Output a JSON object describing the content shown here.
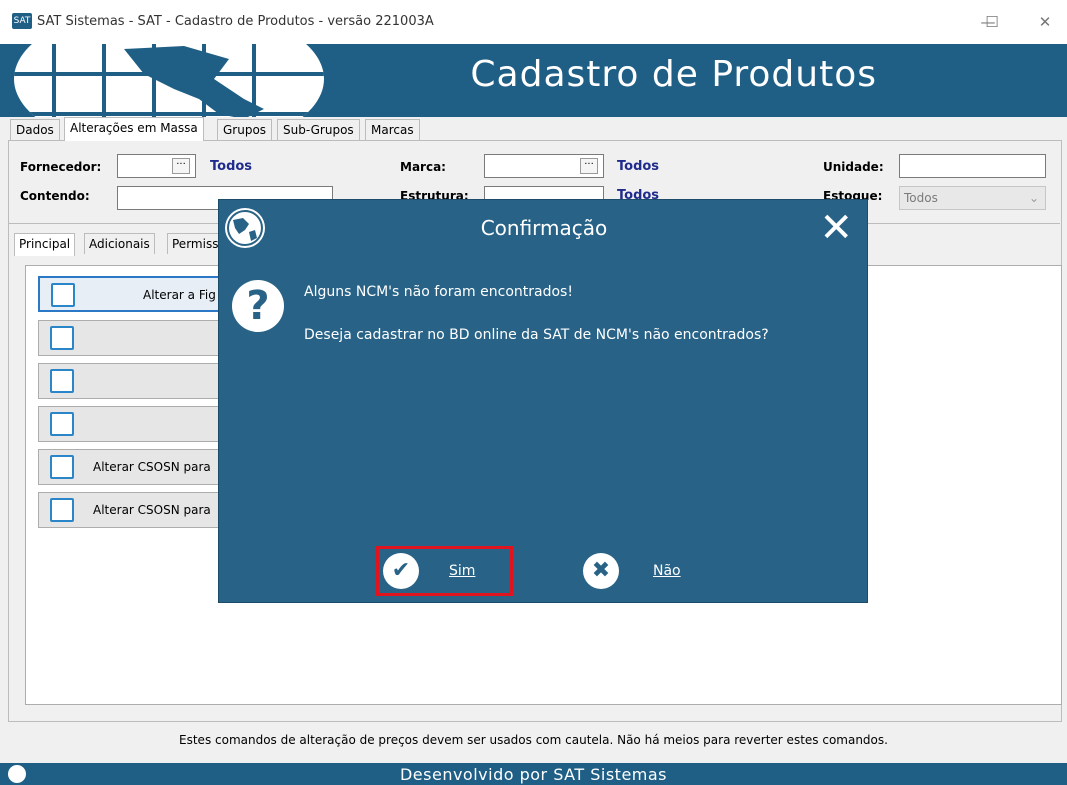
{
  "window": {
    "title": "SAT Sistemas - SAT - Cadastro de Produtos - versão 221003A",
    "app_icon_text": "SAT",
    "minimize": "—",
    "maximize": "☐",
    "close": "✕"
  },
  "banner": {
    "title": "Cadastro de Produtos"
  },
  "main_tabs": [
    "Dados",
    "Alterações em Massa",
    "Grupos",
    "Sub-Grupos",
    "Marcas"
  ],
  "filters": {
    "fornecedor_label": "Fornecedor:",
    "fornecedor_all": "Todos",
    "contendo_label": "Contendo:",
    "marca_label": "Marca:",
    "marca_all": "Todos",
    "estrutura_label": "Estrutura:",
    "estrutura_all": "Todos",
    "unidade_label": "Unidade:",
    "estoque_label": "Estoque:",
    "estoque_value": "Todos",
    "lookup_button": "···"
  },
  "sub_tabs": [
    "Principal",
    "Adicionais",
    "Permiss"
  ],
  "actions": [
    "Alterar a Fig",
    "",
    "",
    "",
    "Alterar CSOSN para",
    "Alterar CSOSN para"
  ],
  "footer_note": "Estes comandos de alteração de preços devem ser usados com cautela. Não há meios para reverter estes comandos.",
  "status_bar": "Desenvolvido por SAT Sistemas",
  "dialog": {
    "title": "Confirmação",
    "close": "✕",
    "message_line1": "Alguns NCM's não foram encontrados!",
    "message_line2": "Deseja cadastrar no BD online da SAT de NCM's não encontrados?",
    "yes_label": "Sim",
    "no_label": "Não",
    "yes_icon": "✔",
    "no_icon": "✖",
    "question_icon": "?"
  }
}
